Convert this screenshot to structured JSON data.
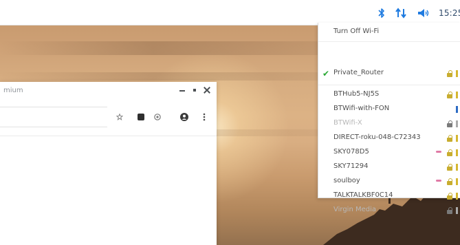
{
  "taskbar": {
    "clock": "15:25"
  },
  "wifi_menu": {
    "turn_off_label": "Turn Off Wi-Fi",
    "connected_network": "Private_Router",
    "networks": [
      "BTHub5-NJ5S",
      "BTWifi-with-FON",
      "BTWifi-X",
      "DIRECT-roku-048-C72343",
      "SKY078D5",
      "SKY71294",
      "soulboy",
      "TALKTALKBF0C14",
      "Virgin Media"
    ]
  },
  "colors": {
    "connected_check": "#28a832",
    "lock": "#c8ad2f",
    "signal": "#d4b730",
    "bluetooth": "#1f7be0"
  }
}
